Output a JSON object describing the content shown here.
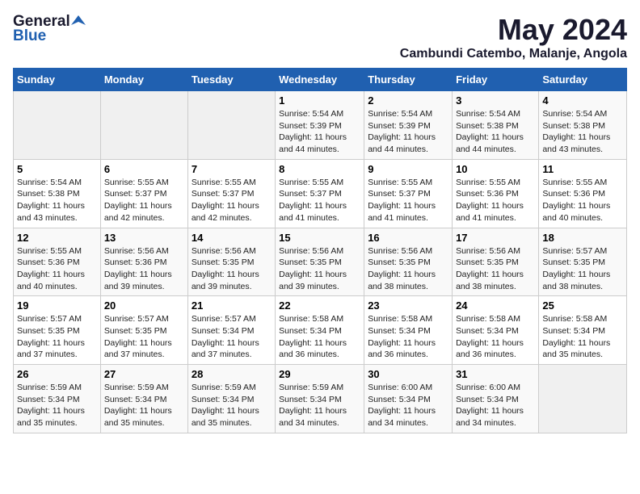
{
  "logo": {
    "general": "General",
    "blue": "Blue"
  },
  "title": "May 2024",
  "location": "Cambundi Catembo, Malanje, Angola",
  "days_of_week": [
    "Sunday",
    "Monday",
    "Tuesday",
    "Wednesday",
    "Thursday",
    "Friday",
    "Saturday"
  ],
  "weeks": [
    [
      {
        "day": "",
        "info": ""
      },
      {
        "day": "",
        "info": ""
      },
      {
        "day": "",
        "info": ""
      },
      {
        "day": "1",
        "info": "Sunrise: 5:54 AM\nSunset: 5:39 PM\nDaylight: 11 hours\nand 44 minutes."
      },
      {
        "day": "2",
        "info": "Sunrise: 5:54 AM\nSunset: 5:39 PM\nDaylight: 11 hours\nand 44 minutes."
      },
      {
        "day": "3",
        "info": "Sunrise: 5:54 AM\nSunset: 5:38 PM\nDaylight: 11 hours\nand 44 minutes."
      },
      {
        "day": "4",
        "info": "Sunrise: 5:54 AM\nSunset: 5:38 PM\nDaylight: 11 hours\nand 43 minutes."
      }
    ],
    [
      {
        "day": "5",
        "info": "Sunrise: 5:54 AM\nSunset: 5:38 PM\nDaylight: 11 hours\nand 43 minutes."
      },
      {
        "day": "6",
        "info": "Sunrise: 5:55 AM\nSunset: 5:37 PM\nDaylight: 11 hours\nand 42 minutes."
      },
      {
        "day": "7",
        "info": "Sunrise: 5:55 AM\nSunset: 5:37 PM\nDaylight: 11 hours\nand 42 minutes."
      },
      {
        "day": "8",
        "info": "Sunrise: 5:55 AM\nSunset: 5:37 PM\nDaylight: 11 hours\nand 41 minutes."
      },
      {
        "day": "9",
        "info": "Sunrise: 5:55 AM\nSunset: 5:37 PM\nDaylight: 11 hours\nand 41 minutes."
      },
      {
        "day": "10",
        "info": "Sunrise: 5:55 AM\nSunset: 5:36 PM\nDaylight: 11 hours\nand 41 minutes."
      },
      {
        "day": "11",
        "info": "Sunrise: 5:55 AM\nSunset: 5:36 PM\nDaylight: 11 hours\nand 40 minutes."
      }
    ],
    [
      {
        "day": "12",
        "info": "Sunrise: 5:55 AM\nSunset: 5:36 PM\nDaylight: 11 hours\nand 40 minutes."
      },
      {
        "day": "13",
        "info": "Sunrise: 5:56 AM\nSunset: 5:36 PM\nDaylight: 11 hours\nand 39 minutes."
      },
      {
        "day": "14",
        "info": "Sunrise: 5:56 AM\nSunset: 5:35 PM\nDaylight: 11 hours\nand 39 minutes."
      },
      {
        "day": "15",
        "info": "Sunrise: 5:56 AM\nSunset: 5:35 PM\nDaylight: 11 hours\nand 39 minutes."
      },
      {
        "day": "16",
        "info": "Sunrise: 5:56 AM\nSunset: 5:35 PM\nDaylight: 11 hours\nand 38 minutes."
      },
      {
        "day": "17",
        "info": "Sunrise: 5:56 AM\nSunset: 5:35 PM\nDaylight: 11 hours\nand 38 minutes."
      },
      {
        "day": "18",
        "info": "Sunrise: 5:57 AM\nSunset: 5:35 PM\nDaylight: 11 hours\nand 38 minutes."
      }
    ],
    [
      {
        "day": "19",
        "info": "Sunrise: 5:57 AM\nSunset: 5:35 PM\nDaylight: 11 hours\nand 37 minutes."
      },
      {
        "day": "20",
        "info": "Sunrise: 5:57 AM\nSunset: 5:35 PM\nDaylight: 11 hours\nand 37 minutes."
      },
      {
        "day": "21",
        "info": "Sunrise: 5:57 AM\nSunset: 5:34 PM\nDaylight: 11 hours\nand 37 minutes."
      },
      {
        "day": "22",
        "info": "Sunrise: 5:58 AM\nSunset: 5:34 PM\nDaylight: 11 hours\nand 36 minutes."
      },
      {
        "day": "23",
        "info": "Sunrise: 5:58 AM\nSunset: 5:34 PM\nDaylight: 11 hours\nand 36 minutes."
      },
      {
        "day": "24",
        "info": "Sunrise: 5:58 AM\nSunset: 5:34 PM\nDaylight: 11 hours\nand 36 minutes."
      },
      {
        "day": "25",
        "info": "Sunrise: 5:58 AM\nSunset: 5:34 PM\nDaylight: 11 hours\nand 35 minutes."
      }
    ],
    [
      {
        "day": "26",
        "info": "Sunrise: 5:59 AM\nSunset: 5:34 PM\nDaylight: 11 hours\nand 35 minutes."
      },
      {
        "day": "27",
        "info": "Sunrise: 5:59 AM\nSunset: 5:34 PM\nDaylight: 11 hours\nand 35 minutes."
      },
      {
        "day": "28",
        "info": "Sunrise: 5:59 AM\nSunset: 5:34 PM\nDaylight: 11 hours\nand 35 minutes."
      },
      {
        "day": "29",
        "info": "Sunrise: 5:59 AM\nSunset: 5:34 PM\nDaylight: 11 hours\nand 34 minutes."
      },
      {
        "day": "30",
        "info": "Sunrise: 6:00 AM\nSunset: 5:34 PM\nDaylight: 11 hours\nand 34 minutes."
      },
      {
        "day": "31",
        "info": "Sunrise: 6:00 AM\nSunset: 5:34 PM\nDaylight: 11 hours\nand 34 minutes."
      },
      {
        "day": "",
        "info": ""
      }
    ]
  ]
}
